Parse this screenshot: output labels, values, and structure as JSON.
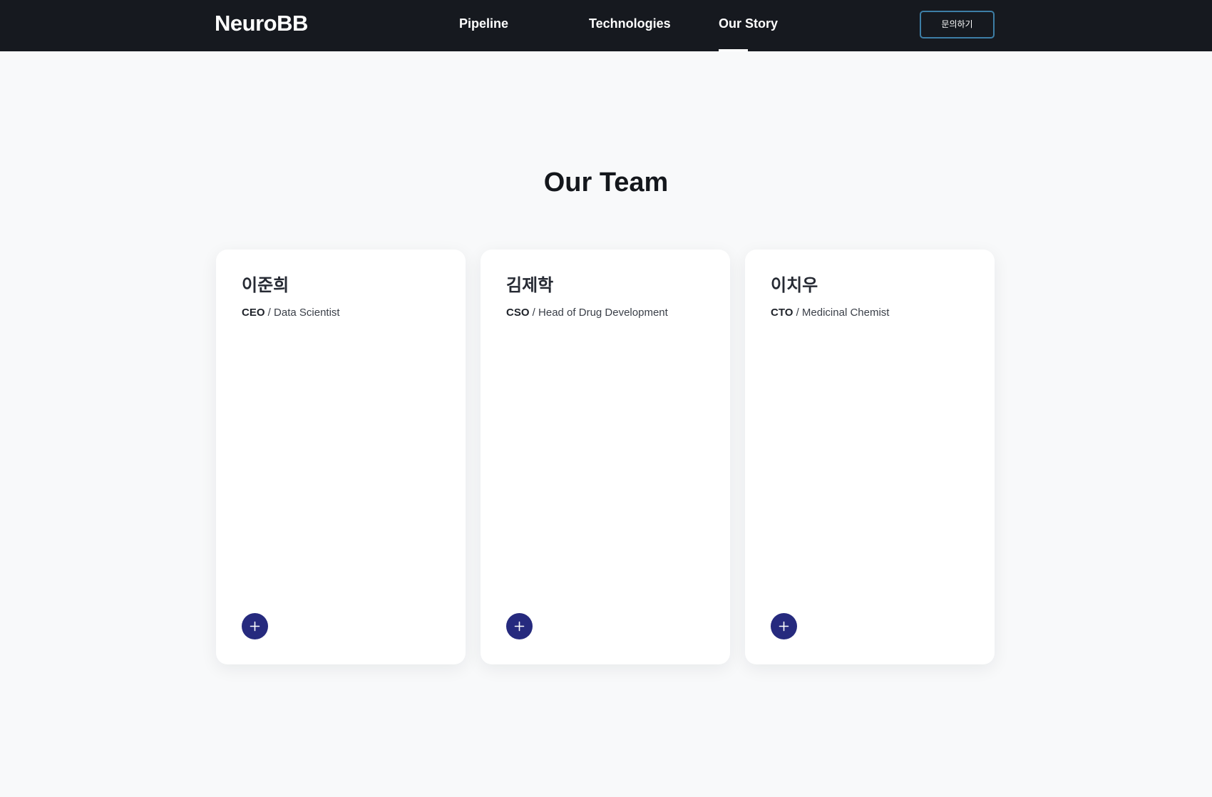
{
  "header": {
    "logo": "NeuroBB",
    "nav": [
      {
        "label": "Pipeline",
        "active": false
      },
      {
        "label": "Technologies",
        "active": false
      },
      {
        "label": "Our Story",
        "active": true
      }
    ],
    "contact_label": "문의하기",
    "accent_color": "#3d7ea6"
  },
  "section": {
    "title": "Our Team"
  },
  "team": [
    {
      "name": "이준희",
      "role_abbr": "CEO",
      "role_separator": " / ",
      "role_title": "Data Scientist",
      "expand_icon": "plus-icon"
    },
    {
      "name": "김제학",
      "role_abbr": "CSO",
      "role_separator": " / ",
      "role_title": "Head of Drug Development",
      "expand_icon": "plus-icon"
    },
    {
      "name": "이치우",
      "role_abbr": "CTO",
      "role_separator": " / ",
      "role_title": "Medicinal Chemist",
      "expand_icon": "plus-icon"
    }
  ],
  "colors": {
    "header_bg": "#16191f",
    "page_bg": "#f8f9fa",
    "plus_button": "#262a7e"
  }
}
